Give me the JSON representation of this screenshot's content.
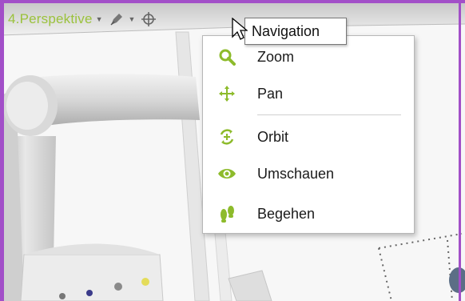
{
  "viewport": {
    "title": "4.Perspektive",
    "frame_color": "#a24fc8",
    "title_color": "#9bc23c"
  },
  "toolbar": {
    "icons": [
      "view-dropdown-arrow",
      "pen-icon",
      "pen-dropdown-arrow",
      "navigation-crosshair-icon"
    ]
  },
  "tooltip": {
    "text": "Navigation"
  },
  "menu": {
    "items": [
      {
        "label": "Zoom",
        "icon": "zoom-icon"
      },
      {
        "label": "Pan",
        "icon": "pan-icon"
      },
      {
        "label": "Orbit",
        "icon": "orbit-icon"
      },
      {
        "label": "Umschauen",
        "icon": "look-around-icon"
      },
      {
        "label": "Begehen",
        "icon": "walk-icon"
      }
    ],
    "icon_color": "#8dbb2b"
  }
}
